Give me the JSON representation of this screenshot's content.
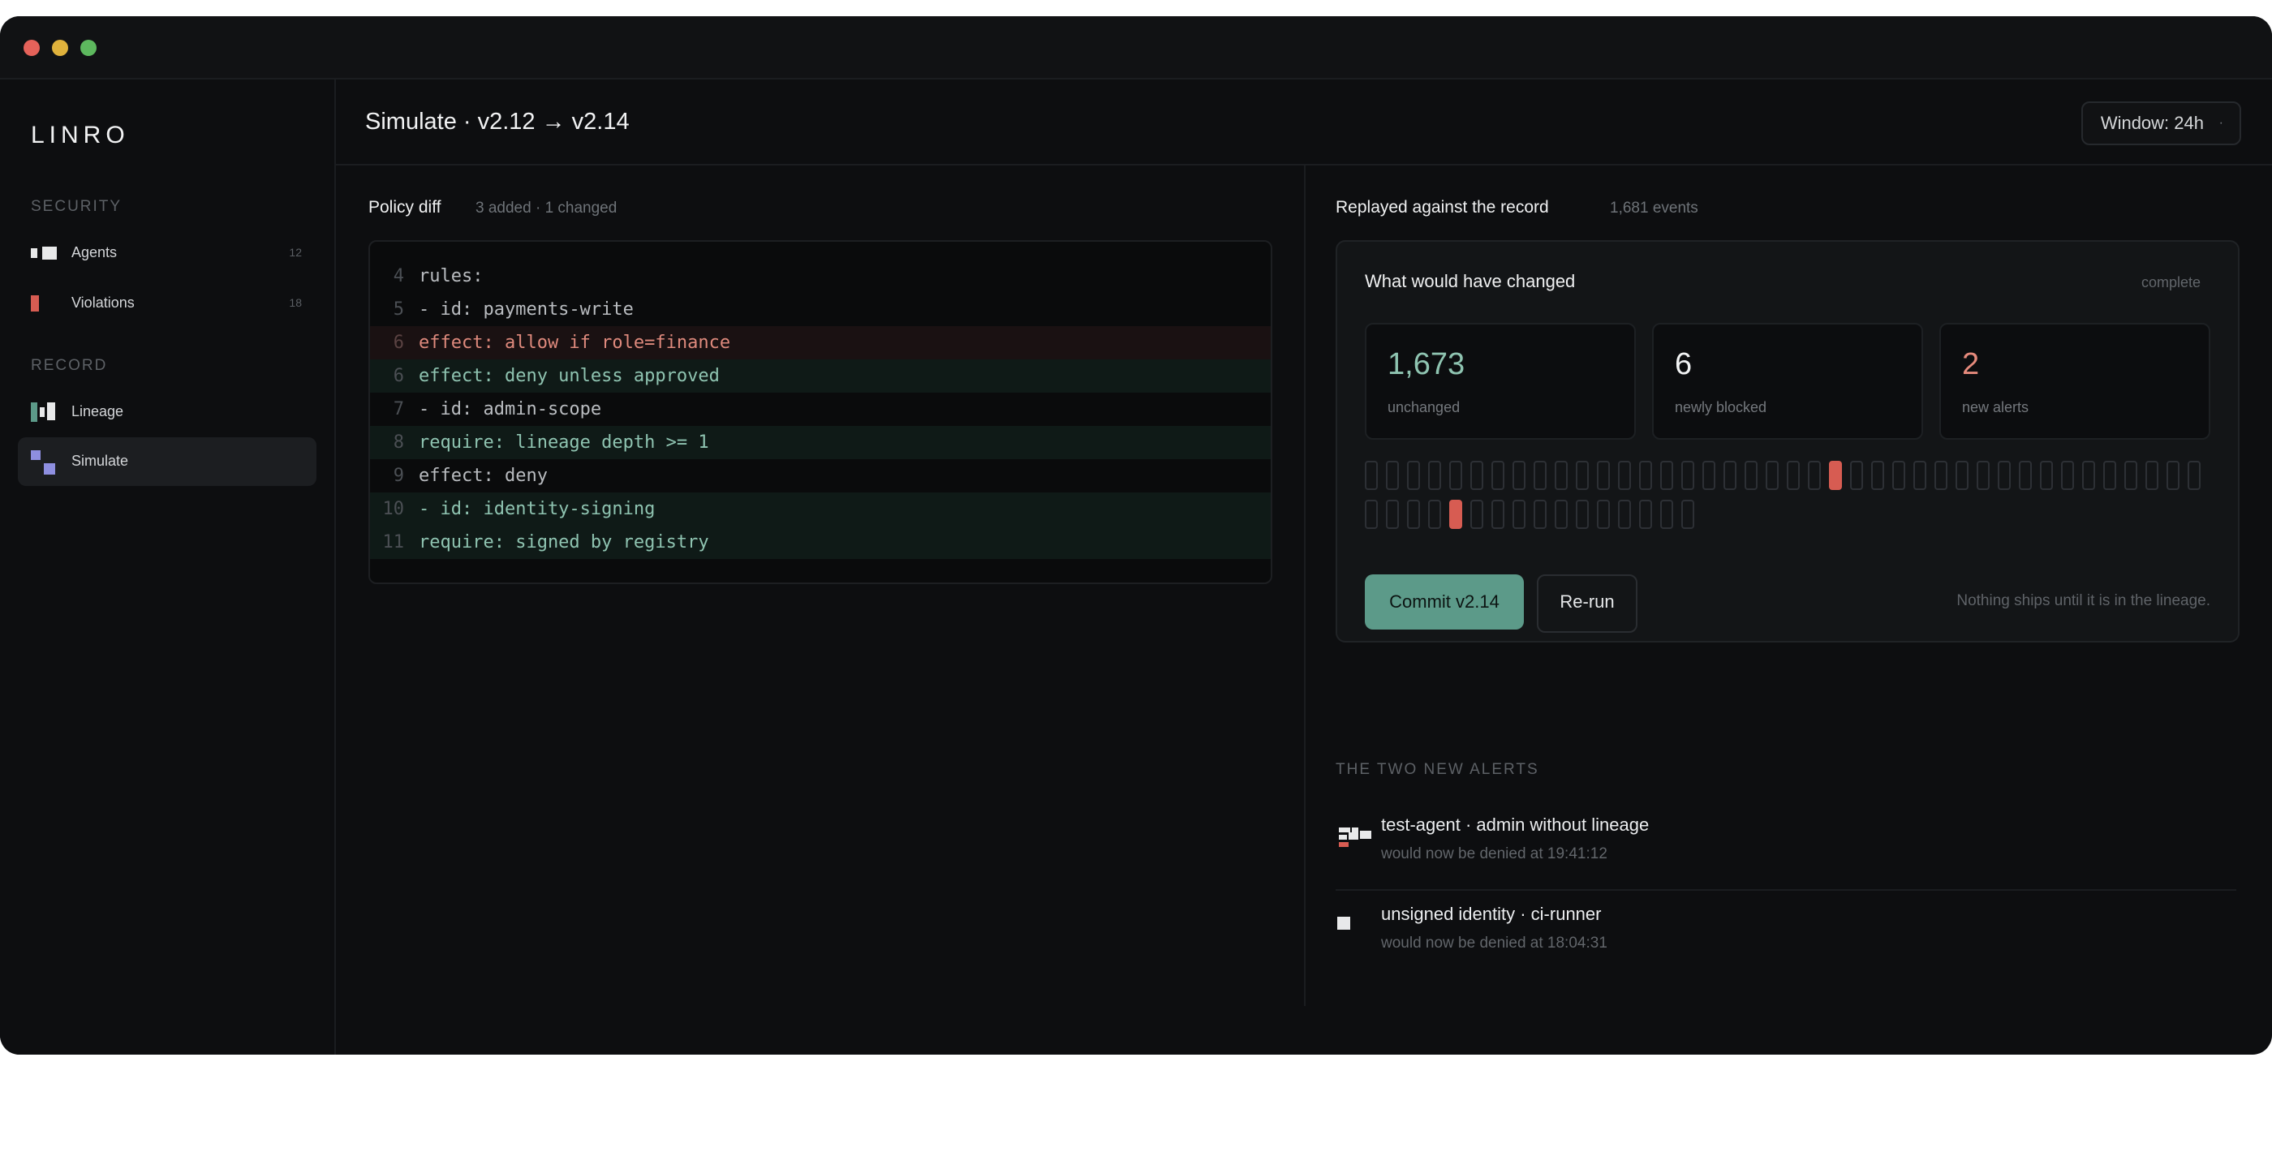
{
  "app": {
    "logo": "LINRO"
  },
  "sidebar": {
    "sections": [
      {
        "label": "SECURITY"
      },
      {
        "label": "RECORD"
      }
    ],
    "items": [
      {
        "label": "Agents",
        "count": "12"
      },
      {
        "label": "Violations",
        "count": "18"
      },
      {
        "label": "Lineage",
        "count": ""
      },
      {
        "label": "Simulate",
        "count": ""
      }
    ]
  },
  "header": {
    "title": "Simulate · v2.12 → v2.14",
    "window_select": "Window: 24h"
  },
  "diff": {
    "title": "Policy diff",
    "summary": "3 added · 1 changed",
    "lines": [
      {
        "ln": "4",
        "text": "rules:",
        "type": "ctx"
      },
      {
        "ln": "5",
        "text": "- id: payments-write",
        "type": "ctx"
      },
      {
        "ln": "6",
        "text": "effect: allow if role=finance",
        "type": "removed"
      },
      {
        "ln": "6",
        "text": "effect: deny unless approved",
        "type": "added"
      },
      {
        "ln": "7",
        "text": "- id: admin-scope",
        "type": "ctx"
      },
      {
        "ln": "8",
        "text": "require: lineage depth >= 1",
        "type": "added"
      },
      {
        "ln": "9",
        "text": "effect: deny",
        "type": "ctx"
      },
      {
        "ln": "10",
        "text": "- id: identity-signing",
        "type": "added"
      },
      {
        "ln": "11",
        "text": "require: signed by registry",
        "type": "added"
      }
    ]
  },
  "replay": {
    "title": "Replayed against the record",
    "events": "1,681 events",
    "card": {
      "title": "What would have changed",
      "status": "complete",
      "stats": [
        {
          "value": "1,673",
          "label": "unchanged",
          "color": "#8fc4b1"
        },
        {
          "value": "6",
          "label": "newly blocked",
          "color": "#f2f3f4"
        },
        {
          "value": "2",
          "label": "new alerts",
          "color": "#e68a7c"
        }
      ],
      "event_ticks": {
        "total": 56,
        "alert_indices": [
          22,
          44
        ]
      },
      "commit_button": "Commit v2.14",
      "rerun_button": "Re-run",
      "note": "Nothing ships until it is in the lineage."
    }
  },
  "alerts": {
    "label": "THE TWO NEW ALERTS",
    "items": [
      {
        "title": "test-agent · admin without lineage",
        "sub": "would now be denied at 19:41:12"
      },
      {
        "title": "unsigned identity · ci-runner",
        "sub": "would now be denied at 18:04:31"
      }
    ]
  },
  "colors": {
    "accent": "#5c9a89",
    "alert": "#d75c52",
    "added_text": "#8fc4b1",
    "removed_text": "#df8a7d"
  }
}
